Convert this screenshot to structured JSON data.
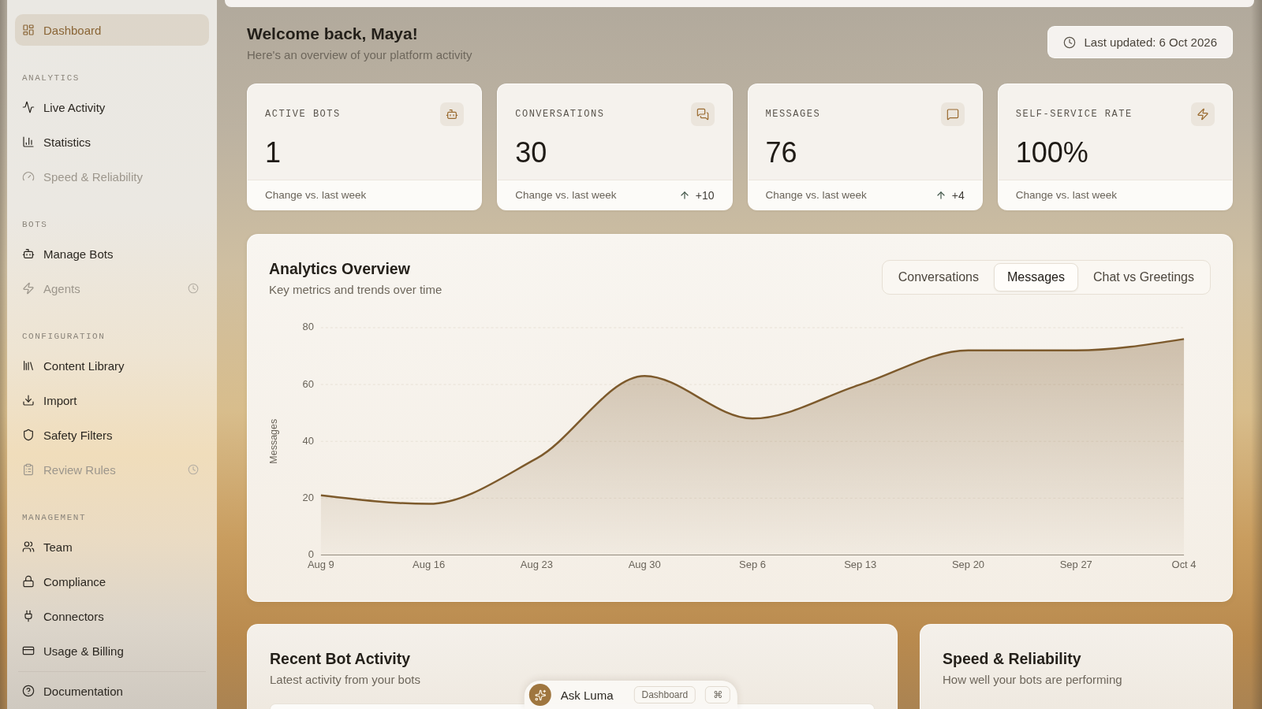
{
  "sidebar": {
    "top_items": [
      {
        "label": "Dashboard",
        "selected": true,
        "disabled": false,
        "coming_soon": false
      }
    ],
    "sections": [
      {
        "heading": "ANALYTICS",
        "items": [
          {
            "label": "Live Activity",
            "selected": false,
            "disabled": false,
            "coming_soon": false
          },
          {
            "label": "Statistics",
            "selected": false,
            "disabled": false,
            "coming_soon": false
          },
          {
            "label": "Speed & Reliability",
            "selected": false,
            "disabled": true,
            "coming_soon": false
          }
        ]
      },
      {
        "heading": "BOTS",
        "items": [
          {
            "label": "Manage Bots",
            "selected": false,
            "disabled": false,
            "coming_soon": false
          },
          {
            "label": "Agents",
            "selected": false,
            "disabled": true,
            "coming_soon": true
          }
        ]
      },
      {
        "heading": "CONFIGURATION",
        "items": [
          {
            "label": "Content Library",
            "selected": false,
            "disabled": false,
            "coming_soon": false
          },
          {
            "label": "Import",
            "selected": false,
            "disabled": false,
            "coming_soon": false
          },
          {
            "label": "Safety Filters",
            "selected": false,
            "disabled": false,
            "coming_soon": false
          },
          {
            "label": "Review Rules",
            "selected": false,
            "disabled": true,
            "coming_soon": true
          }
        ]
      },
      {
        "heading": "MANAGEMENT",
        "items": [
          {
            "label": "Team",
            "selected": false,
            "disabled": false,
            "coming_soon": false
          },
          {
            "label": "Compliance",
            "selected": false,
            "disabled": false,
            "coming_soon": false
          },
          {
            "label": "Connectors",
            "selected": false,
            "disabled": false,
            "coming_soon": false
          },
          {
            "label": "Usage & Billing",
            "selected": false,
            "disabled": false,
            "coming_soon": false
          }
        ]
      }
    ],
    "bottom_items": [
      {
        "label": "Documentation",
        "selected": false,
        "disabled": false,
        "coming_soon": false
      }
    ]
  },
  "header": {
    "title": "Welcome back, Maya!",
    "subtitle": "Here's an overview of your platform activity",
    "last_updated": "Last updated: 6 Oct 2026"
  },
  "stats": [
    {
      "label": "ACTIVE BOTS",
      "value": "1",
      "note": "Change vs. last week"
    },
    {
      "label": "CONVERSATIONS",
      "value": "30",
      "note": "Change vs. last week",
      "delta": "+10"
    },
    {
      "label": "MESSAGES",
      "value": "76",
      "note": "Change vs. last week",
      "delta": "+4"
    },
    {
      "label": "SELF-SERVICE RATE",
      "value": "100%",
      "note": "Change vs. last week"
    }
  ],
  "analytics": {
    "title": "Analytics Overview",
    "subtitle": "Key metrics and trends over time",
    "tabs": [
      {
        "label": "Conversations",
        "selected": false
      },
      {
        "label": "Messages",
        "selected": true
      },
      {
        "label": "Chat vs Greetings",
        "selected": false
      }
    ],
    "chart_data": {
      "type": "area",
      "ylabel": "Messages",
      "categories": [
        "Aug 9",
        "Aug 16",
        "Aug 23",
        "Aug 30",
        "Sep 6",
        "Sep 13",
        "Sep 20",
        "Sep 27",
        "Oct 4"
      ],
      "series": [
        {
          "color": "#7d5a2c",
          "values": [
            21,
            18,
            34,
            63,
            48,
            60,
            72,
            72,
            76
          ]
        }
      ],
      "ylim": [
        0,
        80
      ],
      "yticks": [
        0,
        20,
        40,
        60,
        80
      ],
      "grid": true
    }
  },
  "recent_activity": {
    "title": "Recent Bot Activity",
    "subtitle": "Latest activity from your bots"
  },
  "speed_reliability": {
    "title": "Speed & Reliability",
    "subtitle": "How well your bots are performing"
  },
  "assistant_bar": {
    "label": "Ask Luma",
    "context": "Dashboard",
    "shortcut": "⌘"
  }
}
